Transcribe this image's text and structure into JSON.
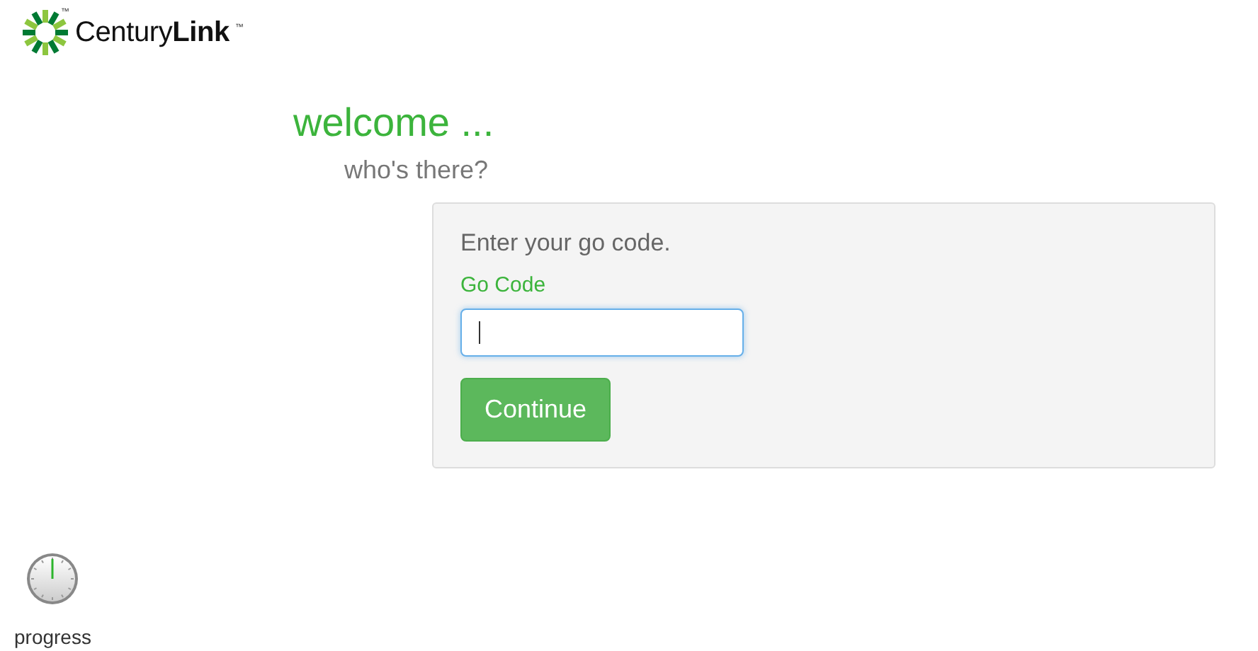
{
  "logo": {
    "icon_tm": "™",
    "name": "Century**Link**",
    "tm": "™"
  },
  "heading": "welcome ...",
  "subheading": "who's there?",
  "form": {
    "prompt": "Enter your go code.",
    "field_label": "Go Code",
    "field": {
      "focused": true
    },
    "button": "Continue"
  },
  "progress": {
    "label": "progress"
  }
}
